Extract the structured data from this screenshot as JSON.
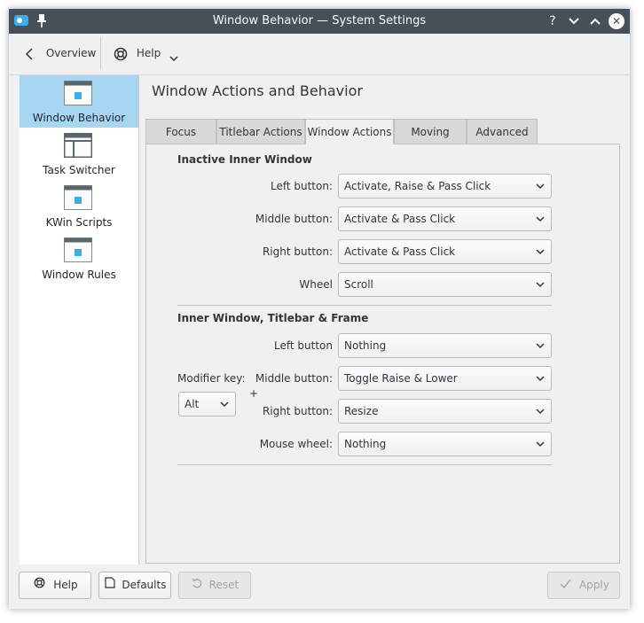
{
  "window": {
    "title": "Window Behavior  — System Settings",
    "controls": {
      "help": "?",
      "minimize": "⌄",
      "maximize": "⌃",
      "close": "✕"
    }
  },
  "toolbar": {
    "overview_label": "Overview",
    "help_label": "Help"
  },
  "sidebar": {
    "items": [
      {
        "label": "Window Behavior",
        "icon": "window-behavior-icon",
        "active": true
      },
      {
        "label": "Task Switcher",
        "icon": "task-switcher-icon",
        "active": false
      },
      {
        "label": "KWin Scripts",
        "icon": "kwin-scripts-icon",
        "active": false
      },
      {
        "label": "Window Rules",
        "icon": "window-rules-icon",
        "active": false
      }
    ]
  },
  "main": {
    "heading": "Window Actions and Behavior",
    "tabs": [
      {
        "label": "Focus",
        "active": false
      },
      {
        "label": "Titlebar Actions",
        "active": false
      },
      {
        "label": "Window Actions",
        "active": true
      },
      {
        "label": "Moving",
        "active": false
      },
      {
        "label": "Advanced",
        "active": false
      }
    ],
    "inactive_section": {
      "title": "Inactive Inner Window",
      "rows": [
        {
          "label": "Left button:",
          "value": "Activate, Raise & Pass Click"
        },
        {
          "label": "Middle button:",
          "value": "Activate & Pass Click"
        },
        {
          "label": "Right button:",
          "value": "Activate & Pass Click"
        },
        {
          "label": "Wheel",
          "value": "Scroll"
        }
      ]
    },
    "inner_section": {
      "title": "Inner Window, Titlebar & Frame",
      "modifier_label": "Modifier key:",
      "modifier_value": "Alt",
      "plus": "+",
      "rows": [
        {
          "label": "Left button",
          "value": "Nothing"
        },
        {
          "label": "Middle button:",
          "value": "Toggle Raise & Lower"
        },
        {
          "label": "Right button:",
          "value": "Resize"
        },
        {
          "label": "Mouse wheel:",
          "value": "Nothing"
        }
      ]
    }
  },
  "footer": {
    "help_label": "Help",
    "defaults_label": "Defaults",
    "reset_label": "Reset",
    "apply_label": "Apply"
  },
  "colors": {
    "titlebar": "#475057",
    "accent_selection": "#a7d6f3",
    "window_bg": "#eff0f1"
  }
}
